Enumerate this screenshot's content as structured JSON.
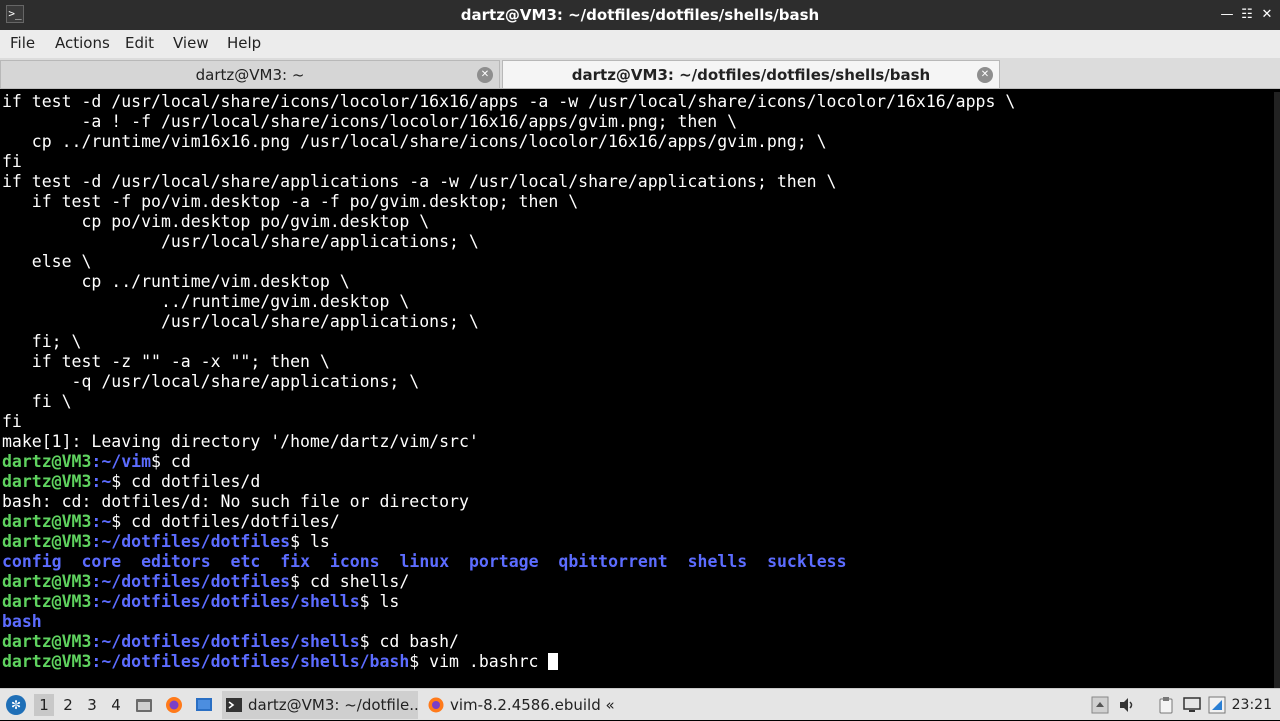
{
  "window": {
    "title": "dartz@VM3: ~/dotfiles/dotfiles/shells/bash",
    "controls": [
      "minimize-icon",
      "restore-icon",
      "close-icon"
    ]
  },
  "menu": [
    "File",
    "Actions",
    "Edit",
    "View",
    "Help"
  ],
  "tabs": [
    {
      "label": "dartz@VM3: ~",
      "active": false
    },
    {
      "label": "dartz@VM3: ~/dotfiles/dotfiles/shells/bash",
      "active": true
    }
  ],
  "terminal": {
    "lines": [
      {
        "type": "text",
        "text": "if test -d /usr/local/share/icons/locolor/16x16/apps -a -w /usr/local/share/icons/locolor/16x16/apps \\"
      },
      {
        "type": "text",
        "text": "        -a ! -f /usr/local/share/icons/locolor/16x16/apps/gvim.png; then \\"
      },
      {
        "type": "text",
        "text": "   cp ../runtime/vim16x16.png /usr/local/share/icons/locolor/16x16/apps/gvim.png; \\"
      },
      {
        "type": "text",
        "text": "fi"
      },
      {
        "type": "text",
        "text": "if test -d /usr/local/share/applications -a -w /usr/local/share/applications; then \\"
      },
      {
        "type": "text",
        "text": "   if test -f po/vim.desktop -a -f po/gvim.desktop; then \\"
      },
      {
        "type": "text",
        "text": "        cp po/vim.desktop po/gvim.desktop \\"
      },
      {
        "type": "text",
        "text": "                /usr/local/share/applications; \\"
      },
      {
        "type": "text",
        "text": "   else \\"
      },
      {
        "type": "text",
        "text": "        cp ../runtime/vim.desktop \\"
      },
      {
        "type": "text",
        "text": "                ../runtime/gvim.desktop \\"
      },
      {
        "type": "text",
        "text": "                /usr/local/share/applications; \\"
      },
      {
        "type": "text",
        "text": "   fi; \\"
      },
      {
        "type": "text",
        "text": "   if test -z \"\" -a -x \"\"; then \\"
      },
      {
        "type": "text",
        "text": "       -q /usr/local/share/applications; \\"
      },
      {
        "type": "text",
        "text": "   fi \\"
      },
      {
        "type": "text",
        "text": "fi"
      },
      {
        "type": "text",
        "text": "make[1]: Leaving directory '/home/dartz/vim/src'"
      },
      {
        "type": "prompt",
        "user": "dartz@VM3",
        "path": "~/vim",
        "cmd": " cd"
      },
      {
        "type": "prompt",
        "user": "dartz@VM3",
        "path": "~",
        "cmd": " cd dotfiles/d"
      },
      {
        "type": "text",
        "text": "bash: cd: dotfiles/d: No such file or directory"
      },
      {
        "type": "prompt",
        "user": "dartz@VM3",
        "path": "~",
        "cmd": " cd dotfiles/dotfiles/"
      },
      {
        "type": "prompt",
        "user": "dartz@VM3",
        "path": "~/dotfiles/dotfiles",
        "cmd": " ls"
      },
      {
        "type": "dirs",
        "items": [
          "config",
          "core",
          "editors",
          "etc",
          "fix",
          "icons",
          "linux",
          "portage",
          "qbittorrent",
          "shells",
          "suckless"
        ]
      },
      {
        "type": "prompt",
        "user": "dartz@VM3",
        "path": "~/dotfiles/dotfiles",
        "cmd": " cd shells/"
      },
      {
        "type": "prompt",
        "user": "dartz@VM3",
        "path": "~/dotfiles/dotfiles/shells",
        "cmd": " ls"
      },
      {
        "type": "dirs",
        "items": [
          "bash"
        ]
      },
      {
        "type": "prompt",
        "user": "dartz@VM3",
        "path": "~/dotfiles/dotfiles/shells",
        "cmd": " cd bash/"
      },
      {
        "type": "prompt",
        "user": "dartz@VM3",
        "path": "~/dotfiles/dotfiles/shells/bash",
        "cmd": " vim .bashrc ",
        "cursor": true
      }
    ]
  },
  "taskbar": {
    "workspaces": [
      "1",
      "2",
      "3",
      "4"
    ],
    "active_workspace": "1",
    "quick_launch": [
      "file-manager-icon",
      "firefox-icon",
      "desktop-icon"
    ],
    "tasks": [
      {
        "label": "dartz@VM3: ~/dotfile...",
        "icon": "terminal-icon",
        "active": true
      },
      {
        "label": "vim-8.2.4586.ebuild « ...",
        "icon": "firefox-icon",
        "active": false
      }
    ],
    "tray": [
      "show-hidden-icon",
      "volume-icon",
      "clipboard-icon",
      "display-icon",
      "network-icon"
    ],
    "clock": "23:21"
  },
  "colors": {
    "prompt_user": "#5fd35f",
    "prompt_path": "#5c6cff",
    "directory": "#5c6cff",
    "terminal_bg": "#000000",
    "terminal_fg": "#ffffff"
  }
}
